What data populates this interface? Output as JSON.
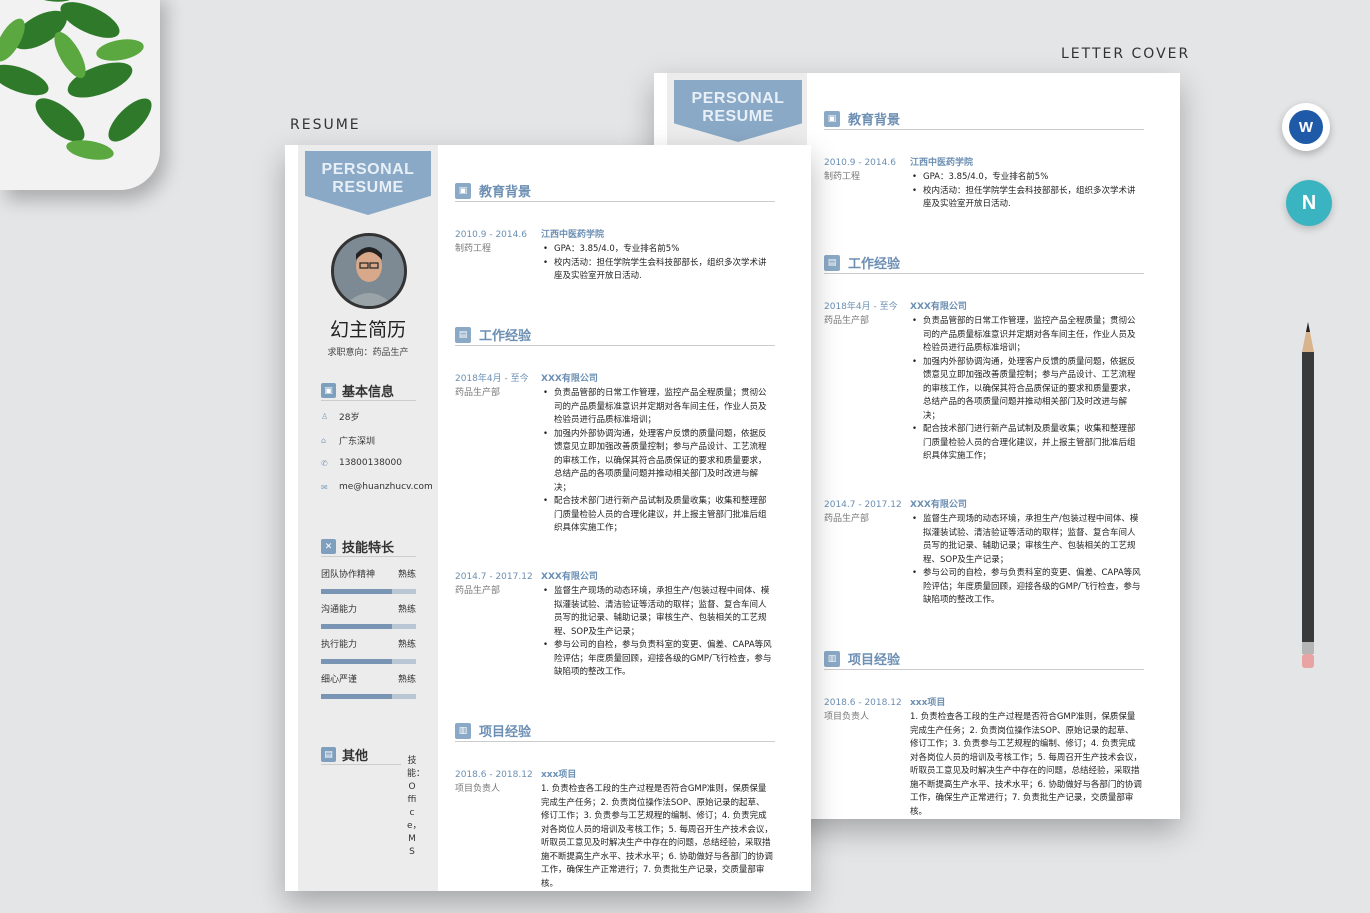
{
  "captions": {
    "resume": "RESUME",
    "letter_cover": "LETTER COVER"
  },
  "banner": {
    "line1": "PERSONAL",
    "line2": "RESUME"
  },
  "profile": {
    "name": "幻主简历",
    "intent": "求职意向：药品生产"
  },
  "basic_info": {
    "title": "基本信息",
    "items": [
      {
        "icon": "person-icon",
        "text": "28岁"
      },
      {
        "icon": "location-icon",
        "text": "广东深圳"
      },
      {
        "icon": "phone-icon",
        "text": "13800138000"
      },
      {
        "icon": "mail-icon",
        "text": "me@huanzhucv.com"
      }
    ]
  },
  "skills": {
    "title": "技能特长",
    "items": [
      {
        "name": "团队协作精神",
        "level_label": "熟练",
        "level": 0.75
      },
      {
        "name": "沟通能力",
        "level_label": "熟练",
        "level": 0.75
      },
      {
        "name": "执行能力",
        "level_label": "熟练",
        "level": 0.75
      },
      {
        "name": "细心严谨",
        "level_label": "熟练",
        "level": 0.75
      }
    ]
  },
  "other": {
    "title": "其他",
    "vertical_text": "技能：Office，MS"
  },
  "education": {
    "title": "教育背景",
    "date": "2010.9 - 2014.6",
    "school": "江西中医药学院",
    "major": "制药工程",
    "bullets": [
      "GPA：3.85/4.0，专业排名前5%",
      "校内活动：担任学院学生会科技部部长，组织多次学术讲座及实验室开放日活动."
    ]
  },
  "work": {
    "title": "工作经验",
    "entries": [
      {
        "date": "2018年4月 - 至今",
        "company": "XXX有限公司",
        "role": "药品生产部",
        "bullets": [
          "负责品管部的日常工作管理，监控产品全程质量；贯彻公司的产品质量标准意识并定期对各车间主任，作业人员及检验员进行品质标准培训；",
          "加强内外部协调沟通，处理客户反馈的质量问题，依据反馈意见立即加强改善质量控制；参与产品设计、工艺流程的审核工作，以确保其符合品质保证的要求和质量要求，总结产品的各项质量问题并推动相关部门及时改进与解决；",
          "配合技术部门进行新产品试制及质量收集；收集和整理部门质量检验人员的合理化建议，并上报主管部门批准后组织具体实施工作；"
        ]
      },
      {
        "date": "2014.7 - 2017.12",
        "company": "XXX有限公司",
        "role": "药品生产部",
        "bullets": [
          "监督生产现场的动态环境，承担生产/包装过程中间体、模拟灌装试验、清洁验证等活动的取样；监督、复合车间人员写的批记录、辅助记录；审核生产、包装相关的工艺规程、SOP及生产记录；",
          "参与公司的自检，参与负责科室的变更、偏差、CAPA等风险评估；年度质量回顾，迎接各级的GMP/飞行检查，参与缺陷项的整改工作。"
        ]
      }
    ]
  },
  "project": {
    "title": "项目经验",
    "date": "2018.6 - 2018.12",
    "name": "xxx项目",
    "role": "项目负责人",
    "description": "1. 负责检查各工段的生产过程是否符合GMP准则，保质保量完成生产任务；2. 负责岗位操作法SOP、原始记录的起草、修订工作；3. 负责参与工艺规程的编制、修订；4. 负责完成对各岗位人员的培训及考核工作；5. 每周召开生产技术会议，听取员工意见及时解决生产中存在的问题，总结经验，采取措施不断提高生产水平、技术水平；6. 协助做好与各部门的协调工作，确保生产正常进行；7. 负责批生产记录，交质量部审核。"
  },
  "icons": {
    "word": "W",
    "note": "N"
  },
  "colors": {
    "accent": "#8aa9c6",
    "heading": "#6c8fb3",
    "sidebar": "#ececec"
  }
}
